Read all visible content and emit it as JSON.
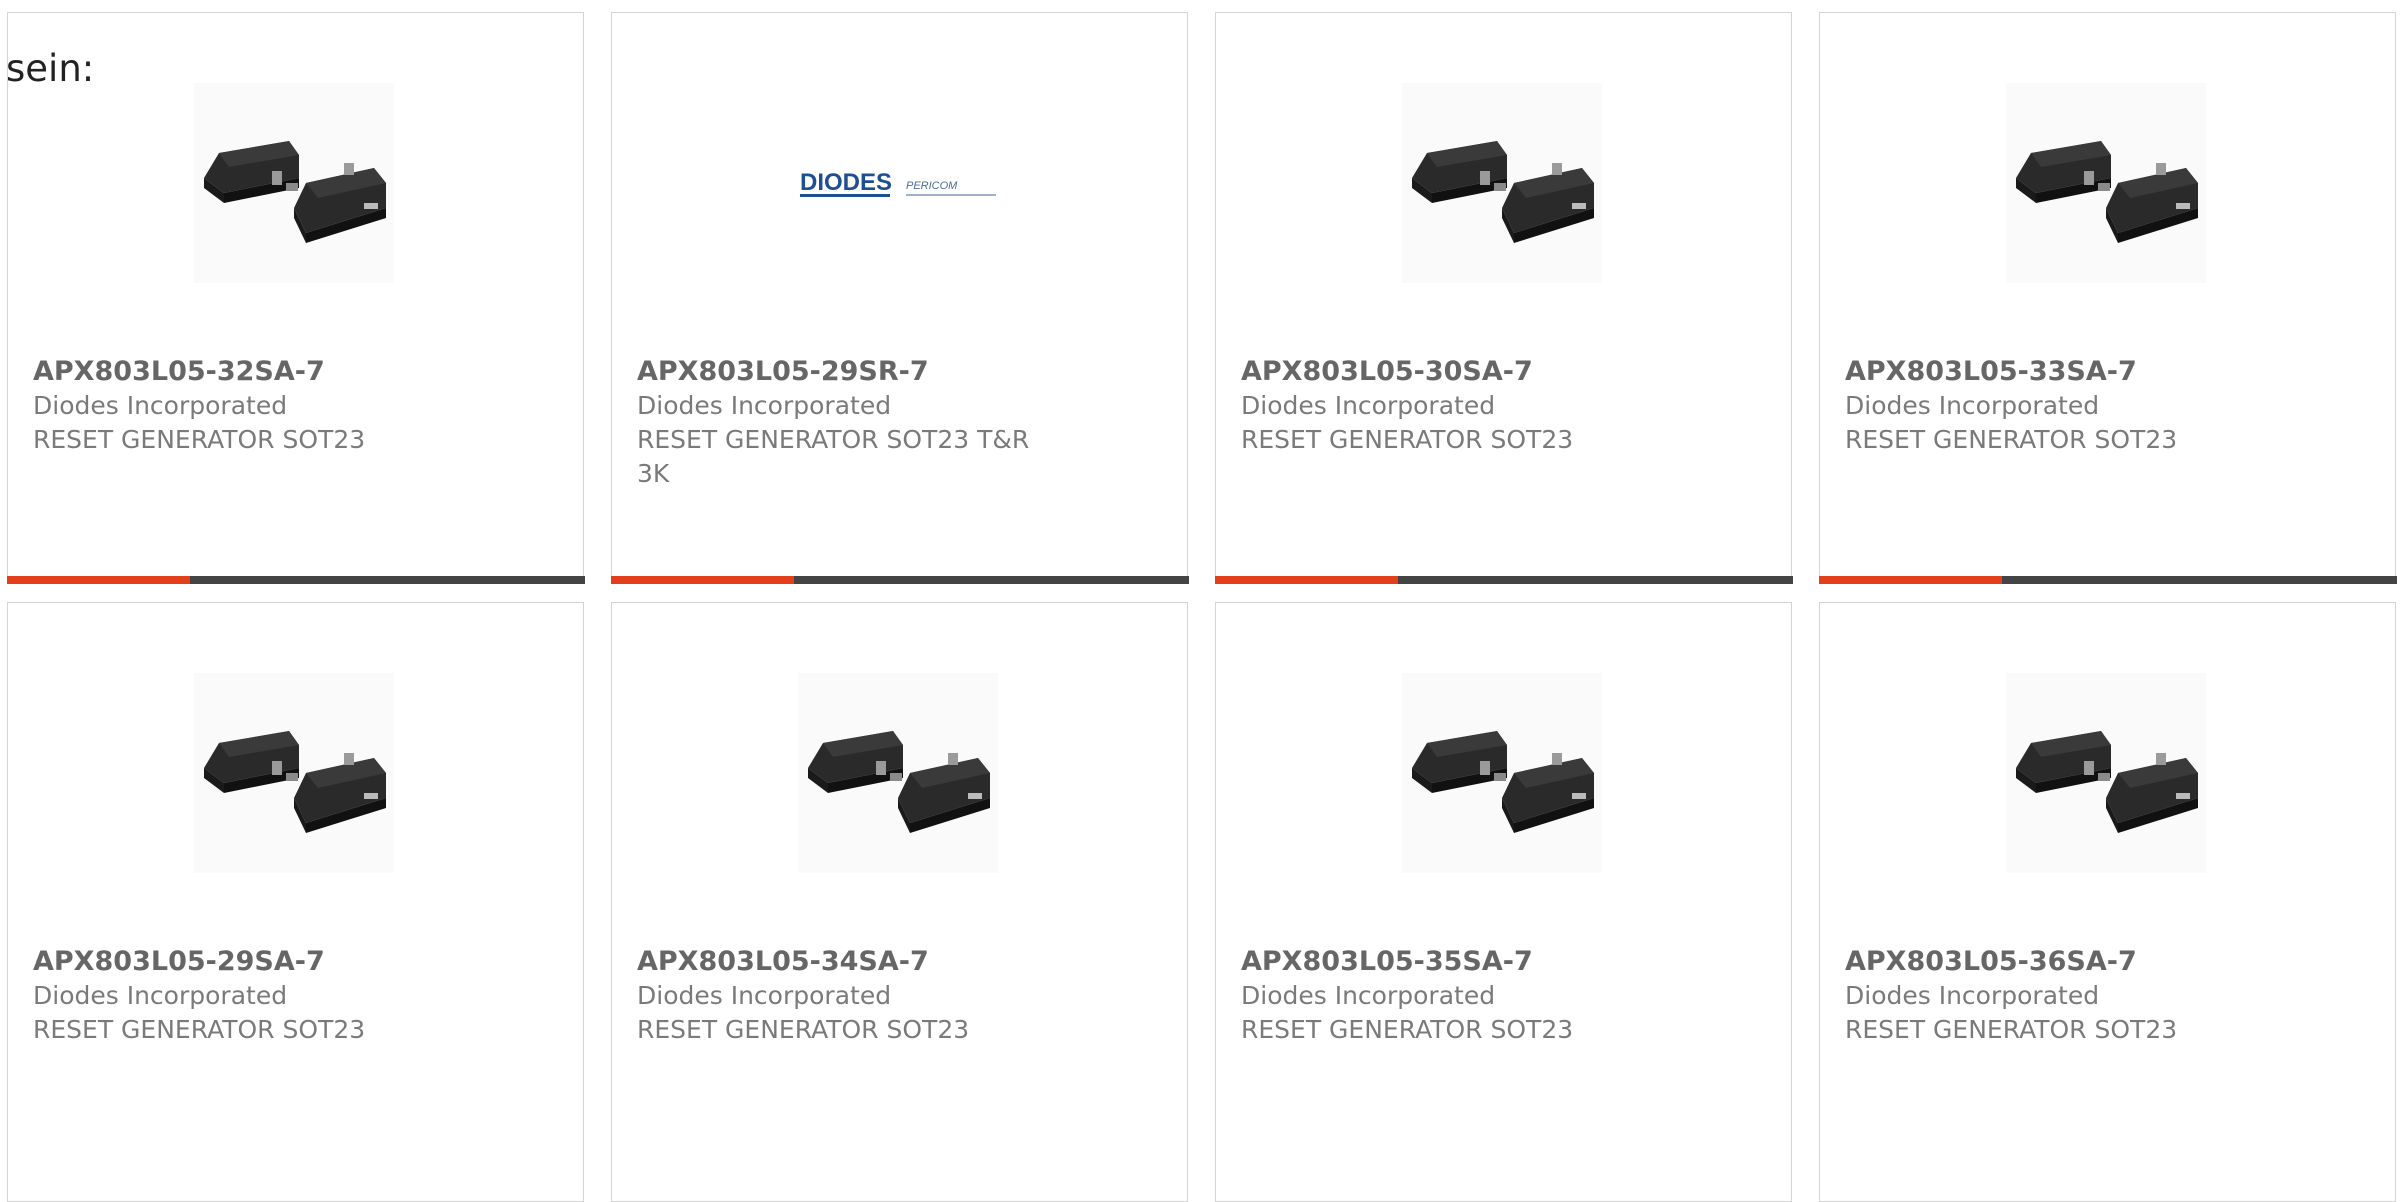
{
  "intro_text": "sein:",
  "colors": {
    "accent": "#e2401c",
    "bar": "#444444"
  },
  "products": [
    {
      "part": "APX803L05-32SA-7",
      "manufacturer": "Diodes Incorporated",
      "description": "RESET GENERATOR SOT23",
      "image": "sot23-package-icon"
    },
    {
      "part": "APX803L05-29SR-7",
      "manufacturer": "Diodes Incorporated",
      "description": "RESET GENERATOR SOT23 T&R 3K",
      "image": "diodes-pericom-logo",
      "logo": {
        "brand": "DIODES",
        "sub": "PERICOM"
      }
    },
    {
      "part": "APX803L05-30SA-7",
      "manufacturer": "Diodes Incorporated",
      "description": "RESET GENERATOR SOT23",
      "image": "sot23-package-icon"
    },
    {
      "part": "APX803L05-33SA-7",
      "manufacturer": "Diodes Incorporated",
      "description": "RESET GENERATOR SOT23",
      "image": "sot23-package-icon"
    },
    {
      "part": "APX803L05-29SA-7",
      "manufacturer": "Diodes Incorporated",
      "description": "RESET GENERATOR SOT23",
      "image": "sot23-package-icon"
    },
    {
      "part": "APX803L05-34SA-7",
      "manufacturer": "Diodes Incorporated",
      "description": "RESET GENERATOR SOT23",
      "image": "sot23-package-icon"
    },
    {
      "part": "APX803L05-35SA-7",
      "manufacturer": "Diodes Incorporated",
      "description": "RESET GENERATOR SOT23",
      "image": "sot23-package-icon"
    },
    {
      "part": "APX803L05-36SA-7",
      "manufacturer": "Diodes Incorporated",
      "description": "RESET GENERATOR SOT23",
      "image": "sot23-package-icon"
    }
  ]
}
